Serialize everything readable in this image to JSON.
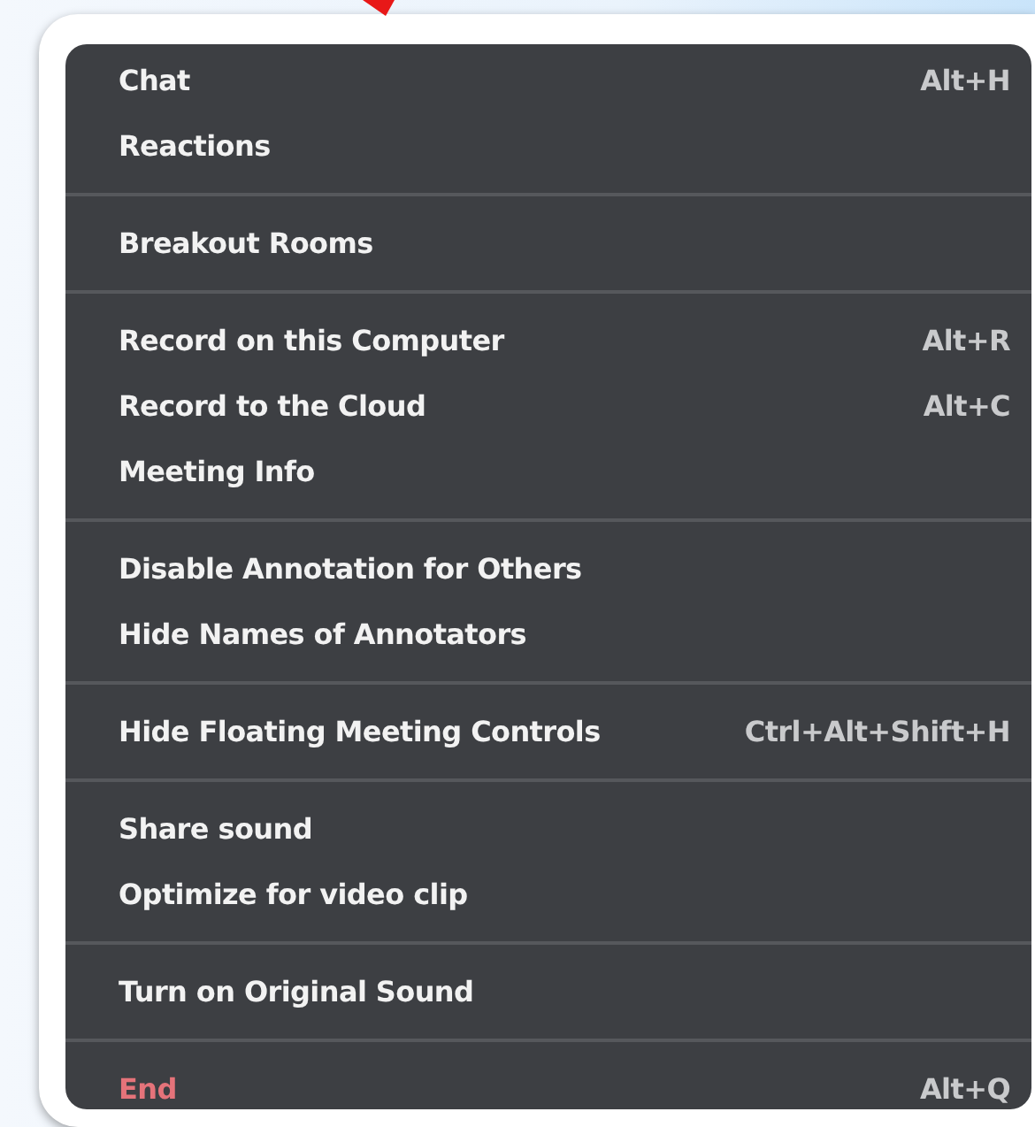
{
  "menu": {
    "sections": [
      {
        "items": [
          {
            "label": "Chat",
            "shortcut": "Alt+H",
            "kind": "normal"
          },
          {
            "label": "Reactions",
            "kind": "normal"
          }
        ]
      },
      {
        "items": [
          {
            "label": "Breakout Rooms",
            "kind": "normal"
          }
        ]
      },
      {
        "items": [
          {
            "label": "Record on this Computer",
            "shortcut": "Alt+R",
            "kind": "normal"
          },
          {
            "label": "Record to the Cloud",
            "shortcut": "Alt+C",
            "kind": "normal"
          },
          {
            "label": "Meeting Info",
            "kind": "normal"
          }
        ]
      },
      {
        "items": [
          {
            "label": "Disable Annotation for Others",
            "kind": "normal"
          },
          {
            "label": "Hide Names of Annotators",
            "kind": "normal"
          }
        ]
      },
      {
        "items": [
          {
            "label": "Hide Floating Meeting Controls",
            "shortcut": "Ctrl+Alt+Shift+H",
            "kind": "normal"
          }
        ]
      },
      {
        "items": [
          {
            "label": "Share sound",
            "kind": "normal"
          },
          {
            "label": "Optimize for video clip",
            "kind": "normal"
          }
        ]
      },
      {
        "items": [
          {
            "label": "Turn on Original Sound",
            "kind": "normal"
          }
        ]
      },
      {
        "items": [
          {
            "label": "End",
            "shortcut": "Alt+Q",
            "kind": "danger"
          }
        ]
      }
    ]
  }
}
